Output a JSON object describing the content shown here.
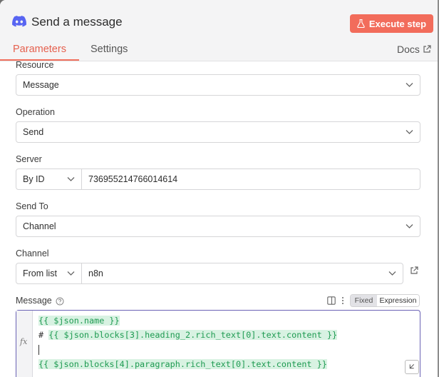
{
  "header": {
    "title": "Send a message",
    "execute_label": "Execute step",
    "tabs": [
      {
        "label": "Parameters",
        "active": true
      },
      {
        "label": "Settings",
        "active": false
      }
    ],
    "docs_label": "Docs"
  },
  "fields": {
    "resource": {
      "label": "Resource",
      "value": "Message"
    },
    "operation": {
      "label": "Operation",
      "value": "Send"
    },
    "server": {
      "label": "Server",
      "mode": "By ID",
      "value": "736955214766014614"
    },
    "send_to": {
      "label": "Send To",
      "value": "Channel"
    },
    "channel": {
      "label": "Channel",
      "mode": "From list",
      "value": "n8n"
    },
    "message": {
      "label": "Message",
      "mode_options": [
        "Fixed",
        "Expression"
      ],
      "selected_mode": "Expression",
      "fx_label": "fx",
      "lines": [
        {
          "prefix": "",
          "expr": "{{ $json.name }}"
        },
        {
          "prefix": "# ",
          "expr": "{{ $json.blocks[3].heading_2.rich_text[0].text.content }}"
        },
        {
          "prefix": "",
          "expr": ""
        },
        {
          "prefix": "",
          "expr": "{{ $json.blocks[4].paragraph.rich_text[0].text.content }}"
        }
      ]
    }
  },
  "colors": {
    "accent": "#f26c5b",
    "active_tab": "#e5604e",
    "expression_bg": "#d8f2e2",
    "expression_text": "#1f9b52",
    "editor_border": "#6b63b5"
  },
  "icons": [
    "discord-icon",
    "flask-icon",
    "external-link-icon",
    "chevron-down-icon",
    "help-icon",
    "panel-toggle-icon",
    "kebab-icon",
    "fx-icon",
    "resize-icon"
  ]
}
